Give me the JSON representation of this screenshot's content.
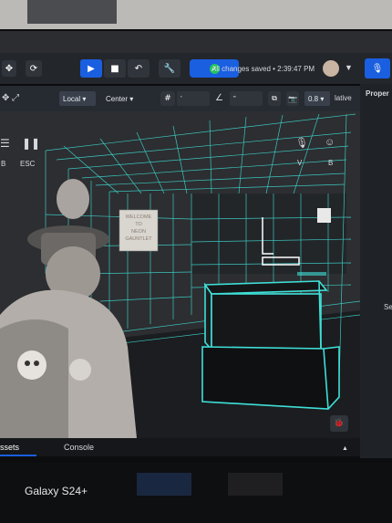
{
  "toolbar": {
    "save_status": "All changes saved • 2:39:47 PM",
    "play_icon": "play-icon",
    "stop_icon": "stop-icon",
    "undo_icon": "undo-icon",
    "wrench_icon": "wrench-icon",
    "check_icon": "check-circle-icon",
    "mic_icon": "mic-off-icon"
  },
  "transform_bar": {
    "space_label": "Local",
    "pivot_label": "Center",
    "snap_label": "’",
    "angle_label": "”",
    "scale_value": "0.8",
    "relative_label": "lative"
  },
  "right_panel": {
    "title": "Proper",
    "letter": "Se"
  },
  "left_controls": {
    "b_label": "B",
    "esc_label": "ESC"
  },
  "scene": {
    "v_label": "V",
    "b_label": "B",
    "sign_lines": [
      "WELCOME",
      "TO",
      "NEON",
      "GAUNTLET"
    ]
  },
  "bottom_tabs": {
    "assets": "ssets",
    "console": "Console"
  },
  "device_watermark": "Galaxy S24+",
  "colors": {
    "neon": "#3fe0d8",
    "accent": "#1a5fe0"
  }
}
